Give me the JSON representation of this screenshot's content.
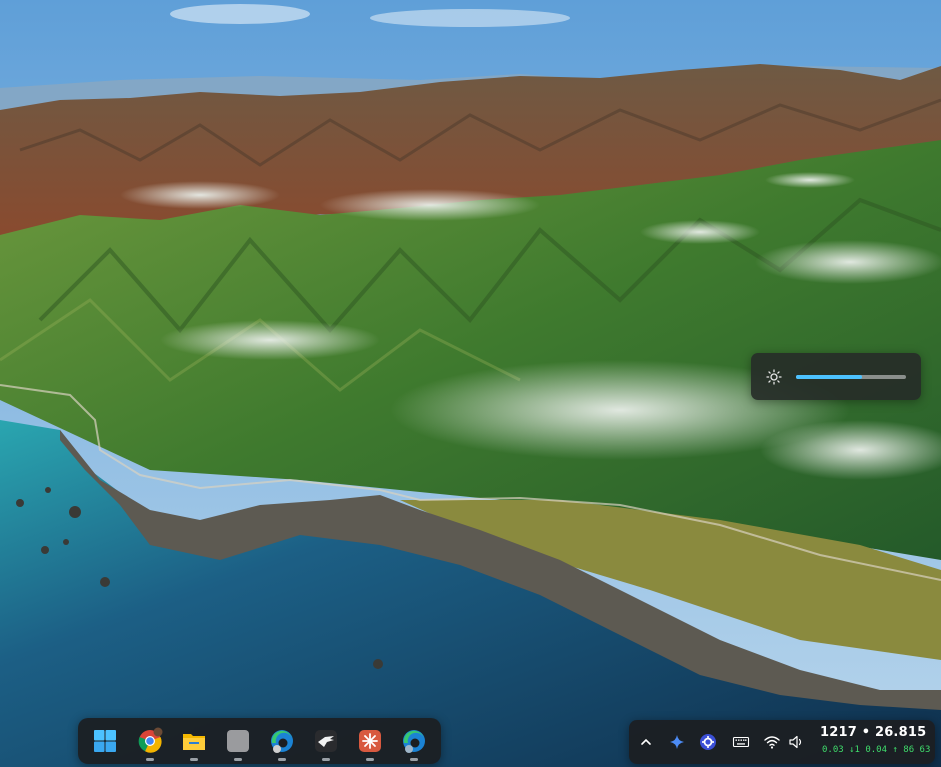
{
  "desktop": {
    "wallpaper_icon": "big-sur-coastline-wallpaper"
  },
  "brightness_flyout": {
    "icon": "sun-icon",
    "level_fraction": 0.6,
    "accent_color": "#4cc2ff"
  },
  "dock": {
    "items": [
      {
        "name": "start-button",
        "icon": "windows-logo-icon",
        "running": false
      },
      {
        "name": "chrome",
        "icon": "chrome-icon",
        "running": true
      },
      {
        "name": "file-explorer",
        "icon": "folder-icon",
        "running": true
      },
      {
        "name": "blank-app",
        "icon": "blank-app-icon",
        "running": true
      },
      {
        "name": "edge-profile",
        "icon": "edge-icon",
        "running": true
      },
      {
        "name": "eagle-app",
        "icon": "eagle-icon",
        "running": true
      },
      {
        "name": "claude-app",
        "icon": "sparkle-icon",
        "running": true
      },
      {
        "name": "edge-profile-2",
        "icon": "edge-icon",
        "running": true
      }
    ]
  },
  "tray": {
    "icons": [
      "chevron-up-icon",
      "sparkle-blue-icon",
      "gear-badge-icon",
      "keyboard-icon",
      "wifi-icon",
      "speaker-icon"
    ],
    "clock_main": "1217 • 26.815",
    "clock_sub": "0.03 ↓1 0.04 ↑ 86 63",
    "clock_sub_color": "#3fdc6b"
  }
}
